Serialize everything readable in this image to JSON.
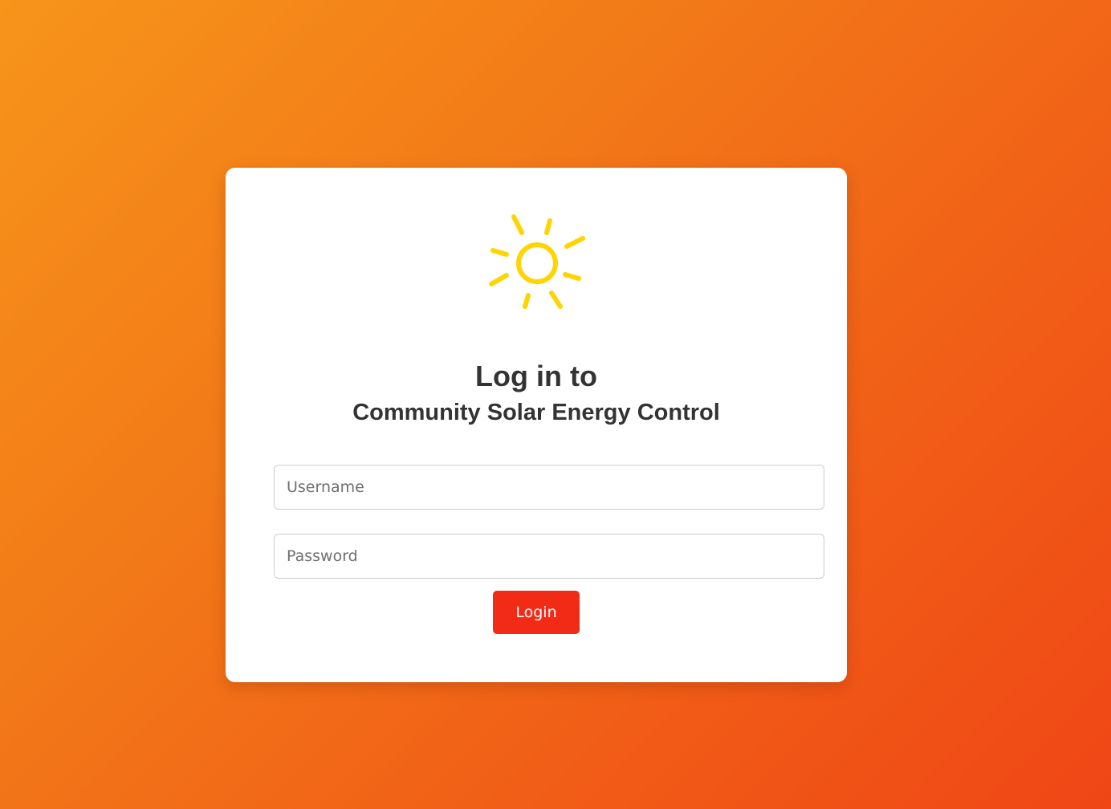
{
  "page": {
    "background_gradient": [
      "#f7941a",
      "#f04616"
    ]
  },
  "logo": {
    "icon": "sun-icon",
    "color": "#ffd400"
  },
  "heading": {
    "line1": "Log in to",
    "line2": "Community Solar Energy Control"
  },
  "form": {
    "username": {
      "value": "",
      "placeholder": "Username"
    },
    "password": {
      "value": "",
      "placeholder": "Password"
    },
    "login_label": "Login",
    "login_color": "#f22b17"
  }
}
